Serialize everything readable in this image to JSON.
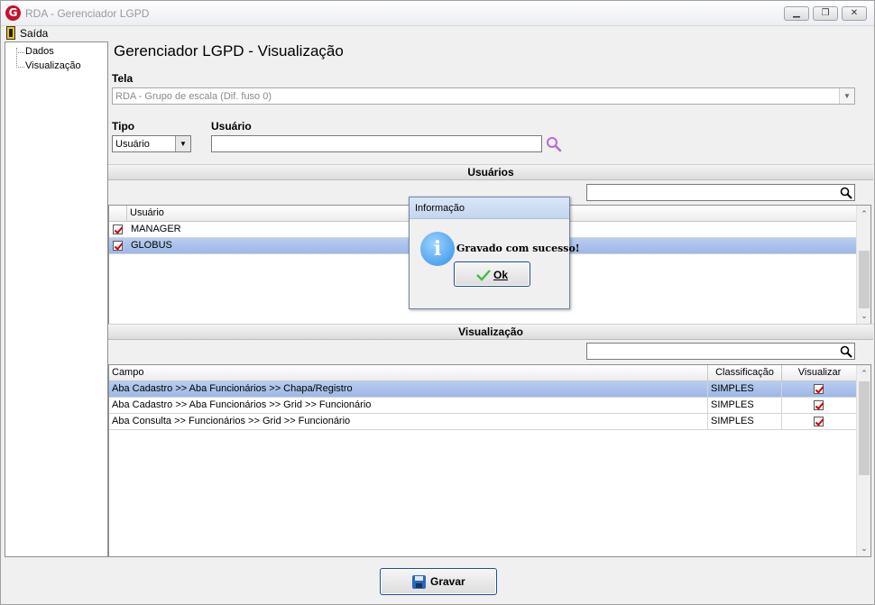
{
  "window": {
    "title": "RDA - Gerenciador LGPD",
    "logo_letter": "G",
    "minimize": "▁",
    "restore": "❐",
    "close": "✕"
  },
  "menu": {
    "exit_label": "Saída"
  },
  "tree": {
    "items": [
      "Dados",
      "Visualização"
    ]
  },
  "page_title": "Gerenciador LGPD - Visualização",
  "tela": {
    "label": "Tela",
    "value": "RDA - Grupo de escala (Dif. fuso 0)"
  },
  "tipo": {
    "label": "Tipo",
    "value": "Usuário"
  },
  "usuario": {
    "label": "Usuário",
    "value": ""
  },
  "users_section": {
    "title": "Usuários",
    "filter_value": "",
    "column": "Usuário",
    "rows": [
      {
        "name": "MANAGER",
        "checked": true,
        "selected": false
      },
      {
        "name": "GLOBUS",
        "checked": true,
        "selected": true
      }
    ]
  },
  "view_section": {
    "title": "Visualização",
    "filter_value": "",
    "columns": {
      "campo": "Campo",
      "classificacao": "Classificação",
      "visualizar": "Visualizar"
    },
    "rows": [
      {
        "campo": "Aba Cadastro >> Aba Funcionários >> Chapa/Registro",
        "classificacao": "SIMPLES",
        "visualizar": true,
        "selected": true
      },
      {
        "campo": "Aba Cadastro >> Aba Funcionários >> Grid >> Funcionário",
        "classificacao": "SIMPLES",
        "visualizar": true,
        "selected": false
      },
      {
        "campo": "Aba Consulta >> Funcionários >> Grid >> Funcionário",
        "classificacao": "SIMPLES",
        "visualizar": true,
        "selected": false
      }
    ]
  },
  "save_button": {
    "label": "Gravar"
  },
  "dialog": {
    "title": "Informação",
    "icon_glyph": "i",
    "message": "Gravado com sucesso!",
    "ok_label": "Ok"
  },
  "icons": {
    "logo": "logo-icon",
    "exit": "exit-door-icon",
    "search": "magnifier-icon",
    "dropdown": "chevron-down-icon",
    "info": "info-icon",
    "ok": "checkmark-icon",
    "save": "floppy-disk-icon"
  },
  "colors": {
    "selection": "#a9c2ec",
    "check_mark": "#d10000",
    "button_border": "#1e4d99"
  }
}
